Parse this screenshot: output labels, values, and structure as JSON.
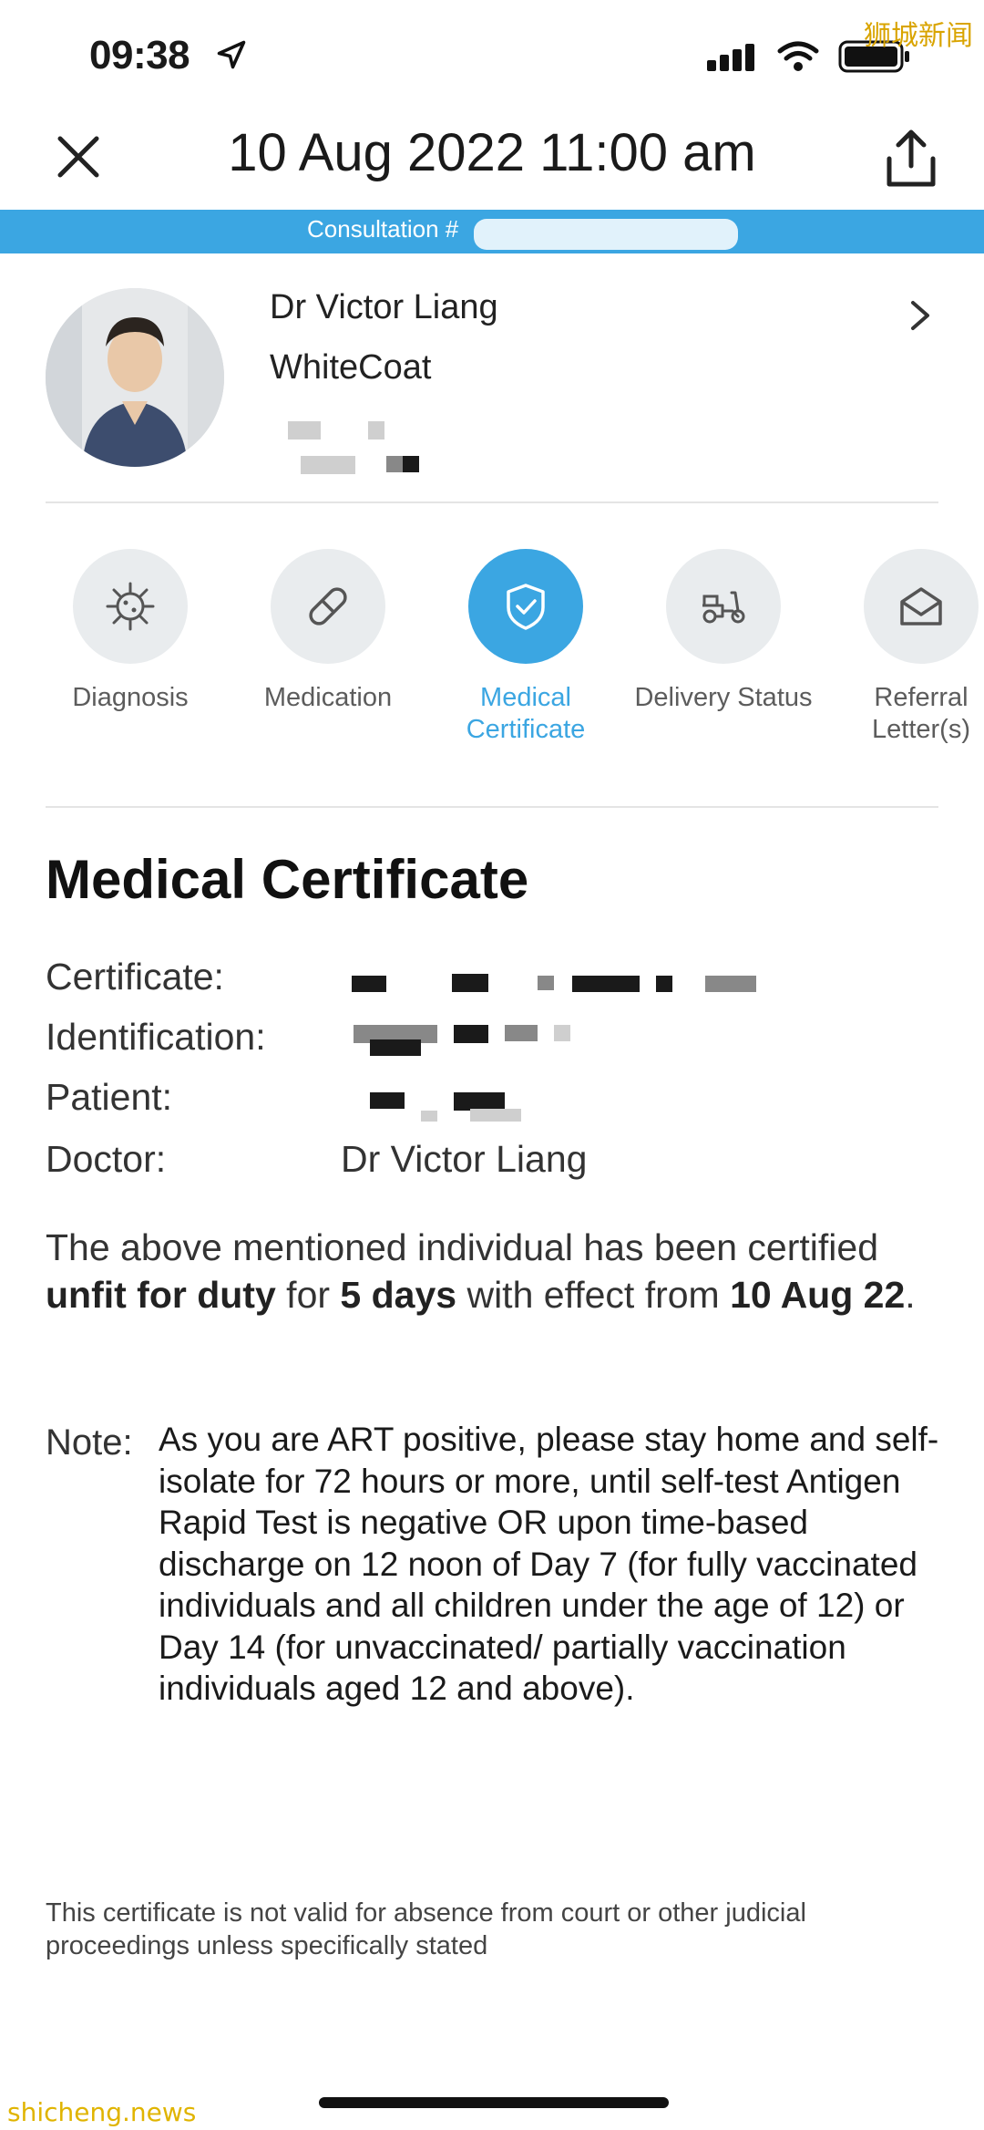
{
  "status_bar": {
    "time": "09:38"
  },
  "watermarks": {
    "top_right": "狮城新闻",
    "bottom_left": "shicheng.news"
  },
  "header": {
    "title": "10 Aug 2022 11:00 am"
  },
  "consultation": {
    "label": "Consultation #"
  },
  "doctor": {
    "name": "Dr Victor Liang",
    "organization": "WhiteCoat"
  },
  "tabs": [
    {
      "label": "Diagnosis",
      "icon": "virus-icon",
      "active": false
    },
    {
      "label": "Medication",
      "icon": "pill-icon",
      "active": false
    },
    {
      "label": "Medical Certificate",
      "icon": "shield-check-icon",
      "active": true
    },
    {
      "label": "Delivery Status",
      "icon": "scooter-icon",
      "active": false
    },
    {
      "label": "Referral Letter(s)",
      "icon": "envelope-icon",
      "active": false
    }
  ],
  "certificate": {
    "heading": "Medical Certificate",
    "fields": {
      "certificate_label": "Certificate:",
      "identification_label": "Identification:",
      "patient_label": "Patient:",
      "doctor_label": "Doctor:",
      "doctor_value": "Dr Victor Liang"
    },
    "statement": {
      "part1": "The above mentioned individual has been certified ",
      "unfit": "unfit for duty",
      "part2": " for ",
      "days": "5 days",
      "part3": " with effect from ",
      "date": "10 Aug 22",
      "part4": "."
    },
    "note_label": "Note:",
    "note_text": "As you are ART positive, please stay home and self-isolate for 72 hours or more, until self-test Antigen Rapid Test is negative OR upon time-based discharge on 12 noon of Day 7 (for fully vaccinated individuals and all children under the age of 12) or Day 14 (for unvaccinated/ partially vaccination individuals aged 12 and above).",
    "disclaimer": "This certificate is not valid for absence from court or other judicial proceedings unless specifically stated"
  },
  "colors": {
    "accent": "#3ba6e2",
    "tab_bg": "#e9ecee",
    "text": "#1a1a1a"
  }
}
